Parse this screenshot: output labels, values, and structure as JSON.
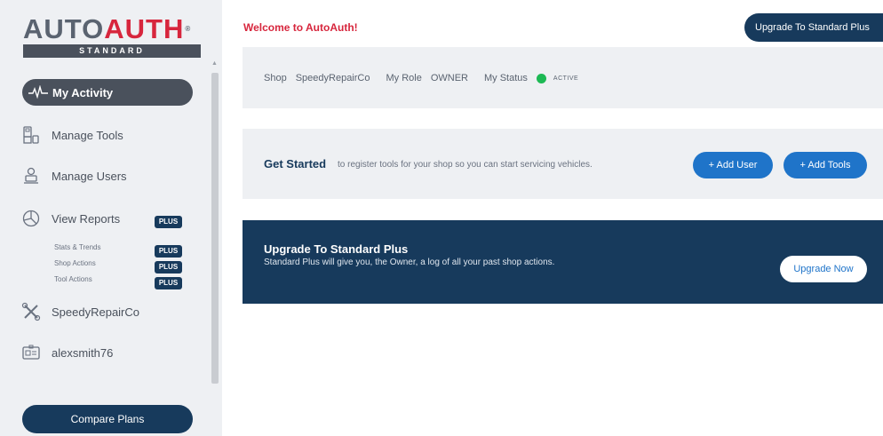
{
  "logo": {
    "part1": "AUTO",
    "part2": "AUTH",
    "reg": "®",
    "tier": "STANDARD"
  },
  "sidebar": {
    "active_item": {
      "label": "My Activity",
      "icon": "activity-pulse-icon"
    },
    "items": [
      {
        "label": "Manage Tools",
        "icon": "tools-icon"
      },
      {
        "label": "Manage Users",
        "icon": "users-icon"
      },
      {
        "label": "View Reports",
        "icon": "pie-chart-icon",
        "badge": "PLUS"
      },
      {
        "label": "SpeedyRepairCo",
        "icon": "wrench-cross-icon"
      },
      {
        "label": "alexsmith76",
        "icon": "id-card-icon"
      }
    ],
    "report_subitems": [
      {
        "label": "Stats & Trends",
        "badge": "PLUS"
      },
      {
        "label": "Shop Actions",
        "badge": "PLUS"
      },
      {
        "label": "Tool Actions",
        "badge": "PLUS"
      }
    ],
    "compare_label": "Compare Plans"
  },
  "header": {
    "welcome": "Welcome to AutoAuth!",
    "upgrade_label": "Upgrade To Standard Plus"
  },
  "info": {
    "shop_label": "Shop",
    "shop_value": "SpeedyRepairCo",
    "role_label": "My Role",
    "role_value": "OWNER",
    "status_label": "My Status",
    "status_value": "ACTIVE"
  },
  "get_started": {
    "title": "Get Started",
    "description": "to register tools for your shop so you can start servicing vehicles.",
    "add_user_label": "+ Add User",
    "add_tools_label": "+ Add Tools"
  },
  "upgrade_banner": {
    "title": "Upgrade To Standard Plus",
    "description": "Standard Plus will give you, the Owner, a log of all your past shop actions.",
    "button_label": "Upgrade Now"
  },
  "colors": {
    "brand_red": "#d7263d",
    "navy": "#173a5c",
    "blue": "#1f74c9",
    "active_green": "#1db954"
  }
}
